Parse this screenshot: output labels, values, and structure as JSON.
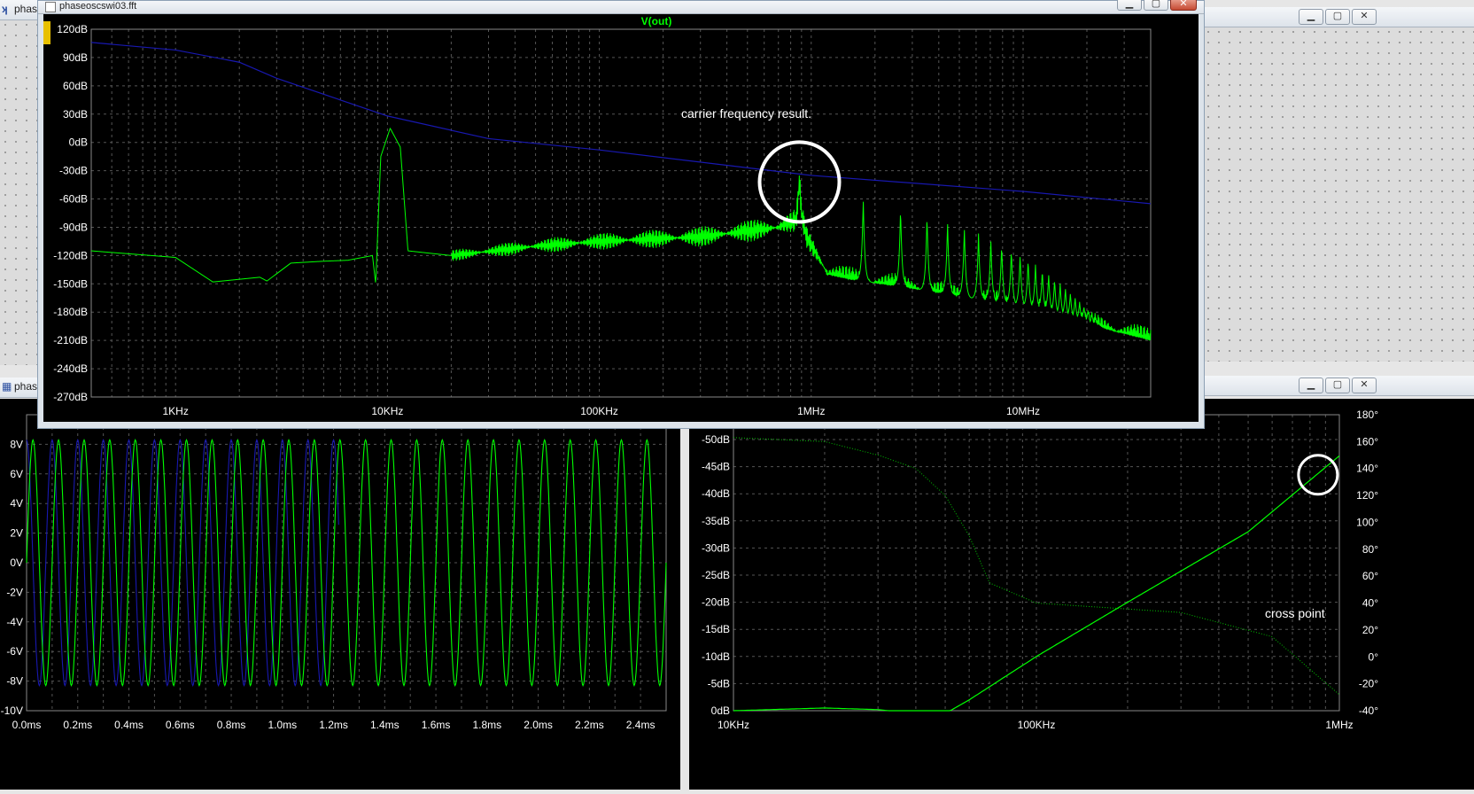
{
  "background_windows": {
    "left_title": "phas",
    "left_lower_title": "phas"
  },
  "fft_window": {
    "title": "phaseoscswi03.fft",
    "trace_label": "V(out)",
    "annotation": "carrier frequency result.",
    "colors": {
      "trace": "#00ff00",
      "reference": "#1818b0",
      "grid": "#555555"
    }
  },
  "bode_window": {
    "annotation": "cross point"
  },
  "chart_data": [
    {
      "type": "line",
      "title": "V(out)",
      "x_scale": "log",
      "xlim": [
        400,
        40000000
      ],
      "ylim": [
        -270,
        120
      ],
      "x_ticks": [
        {
          "v": 1000,
          "label": "1KHz"
        },
        {
          "v": 10000,
          "label": "10KHz"
        },
        {
          "v": 100000,
          "label": "100KHz"
        },
        {
          "v": 1000000,
          "label": "1MHz"
        },
        {
          "v": 10000000,
          "label": "10MHz"
        }
      ],
      "y_ticks": [
        {
          "v": 120,
          "label": "120dB"
        },
        {
          "v": 90,
          "label": "90dB"
        },
        {
          "v": 60,
          "label": "60dB"
        },
        {
          "v": 30,
          "label": "30dB"
        },
        {
          "v": 0,
          "label": "0dB"
        },
        {
          "v": -30,
          "label": "-30dB"
        },
        {
          "v": -60,
          "label": "-60dB"
        },
        {
          "v": -90,
          "label": "-90dB"
        },
        {
          "v": -120,
          "label": "-120dB"
        },
        {
          "v": -150,
          "label": "-150dB"
        },
        {
          "v": -180,
          "label": "-180dB"
        },
        {
          "v": -210,
          "label": "-210dB"
        },
        {
          "v": -240,
          "label": "-240dB"
        },
        {
          "v": -270,
          "label": "-270dB"
        }
      ],
      "grid": true,
      "series": [
        {
          "color": "#00ff00",
          "x": [
            400,
            1000,
            1500,
            2500,
            2700,
            3500,
            5000,
            6500,
            8500,
            8800,
            9300,
            10300,
            11500,
            12500,
            20000,
            50000,
            100000,
            300000,
            700000,
            850000,
            880000,
            900000,
            950000,
            1200000,
            1500000,
            3000000,
            10000000,
            40000000
          ],
          "y": [
            -115,
            -122,
            -148,
            -143,
            -147,
            -128,
            -126,
            -125,
            -120,
            -150,
            -15,
            15,
            -5,
            -115,
            -120,
            -110,
            -105,
            -100,
            -90,
            -82,
            -40,
            -75,
            -100,
            -140,
            -145,
            -155,
            -175,
            -210
          ]
        },
        {
          "color": "#1818b0",
          "x": [
            400,
            1000,
            2000,
            3000,
            10000,
            30000,
            100000,
            1000000,
            10000000,
            40000000
          ],
          "y": [
            106,
            98,
            85,
            68,
            28,
            4,
            -8,
            -35,
            -52,
            -65
          ]
        }
      ]
    },
    {
      "type": "line",
      "xlim": [
        0,
        2.5
      ],
      "ylim": [
        -10,
        10
      ],
      "x_ticks": [
        {
          "v": 0.0,
          "label": "0.0ms"
        },
        {
          "v": 0.2,
          "label": "0.2ms"
        },
        {
          "v": 0.4,
          "label": "0.4ms"
        },
        {
          "v": 0.6,
          "label": "0.6ms"
        },
        {
          "v": 0.8,
          "label": "0.8ms"
        },
        {
          "v": 1.0,
          "label": "1.0ms"
        },
        {
          "v": 1.2,
          "label": "1.2ms"
        },
        {
          "v": 1.4,
          "label": "1.4ms"
        },
        {
          "v": 1.6,
          "label": "1.6ms"
        },
        {
          "v": 1.8,
          "label": "1.8ms"
        },
        {
          "v": 2.0,
          "label": "2.0ms"
        },
        {
          "v": 2.2,
          "label": "2.2ms"
        },
        {
          "v": 2.4,
          "label": "2.4ms"
        }
      ],
      "y_ticks": [
        {
          "v": 8,
          "label": "8V"
        },
        {
          "v": 6,
          "label": "6V"
        },
        {
          "v": 4,
          "label": "4V"
        },
        {
          "v": 2,
          "label": "2V"
        },
        {
          "v": 0,
          "label": "0V"
        },
        {
          "v": -2,
          "label": "-2V"
        },
        {
          "v": -4,
          "label": "-4V"
        },
        {
          "v": -6,
          "label": "-6V"
        },
        {
          "v": -8,
          "label": "-8V"
        },
        {
          "v": -10,
          "label": "-10V"
        }
      ],
      "grid": true,
      "series": [
        {
          "color": "#00ff00",
          "waveform": "sine",
          "amplitude": 8.3,
          "frequency_khz": 10,
          "x_range": [
            0,
            2.5
          ]
        },
        {
          "color": "#1818b0",
          "waveform": "sine",
          "amplitude": 8.3,
          "frequency_khz": 10,
          "phase_deg": 90,
          "x_range": [
            0,
            1.22
          ]
        }
      ]
    },
    {
      "type": "line",
      "x_scale": "log",
      "xlim": [
        10000,
        1000000
      ],
      "ylim": [
        -50,
        0
      ],
      "y2lim": [
        -40,
        180
      ],
      "x_ticks": [
        {
          "v": 10000,
          "label": "10KHz"
        },
        {
          "v": 100000,
          "label": "100KHz"
        },
        {
          "v": 1000000,
          "label": "1MHz"
        }
      ],
      "y_ticks": [
        {
          "v": 0,
          "label": "0dB"
        },
        {
          "v": -5,
          "label": "-5dB"
        },
        {
          "v": -10,
          "label": "-10dB"
        },
        {
          "v": -15,
          "label": "-15dB"
        },
        {
          "v": -20,
          "label": "-20dB"
        },
        {
          "v": -25,
          "label": "-25dB"
        },
        {
          "v": -30,
          "label": "-30dB"
        },
        {
          "v": -35,
          "label": "-35dB"
        },
        {
          "v": -40,
          "label": "-40dB"
        },
        {
          "v": -45,
          "label": "-45dB"
        },
        {
          "v": -50,
          "label": "-50dB"
        }
      ],
      "y2_ticks": [
        {
          "v": 180,
          "label": "180°"
        },
        {
          "v": 160,
          "label": "160°"
        },
        {
          "v": 140,
          "label": "140°"
        },
        {
          "v": 120,
          "label": "120°"
        },
        {
          "v": 100,
          "label": "100°"
        },
        {
          "v": 80,
          "label": "80°"
        },
        {
          "v": 60,
          "label": "60°"
        },
        {
          "v": 40,
          "label": "40°"
        },
        {
          "v": 20,
          "label": "20°"
        },
        {
          "v": 0,
          "label": "0°"
        },
        {
          "v": -20,
          "label": "-20°"
        },
        {
          "v": -40,
          "label": "-40°"
        }
      ],
      "grid": true,
      "series": [
        {
          "color": "#00ff00",
          "axis": "y",
          "style": "solid",
          "x": [
            10000,
            20000,
            30000,
            40000,
            45000,
            60000,
            100000,
            200000,
            500000,
            1000000
          ],
          "y": [
            0,
            -0.5,
            -0.2,
            0.5,
            2,
            -2,
            -10,
            -20,
            -33,
            -47
          ]
        },
        {
          "color": "#00c000",
          "axis": "y2",
          "style": "dotted",
          "x": [
            10000,
            20000,
            30000,
            40000,
            50000,
            60000,
            70000,
            100000,
            300000,
            600000,
            1000000
          ],
          "y": [
            163,
            160,
            150,
            140,
            120,
            90,
            55,
            40,
            33,
            15,
            -28
          ]
        }
      ]
    }
  ]
}
